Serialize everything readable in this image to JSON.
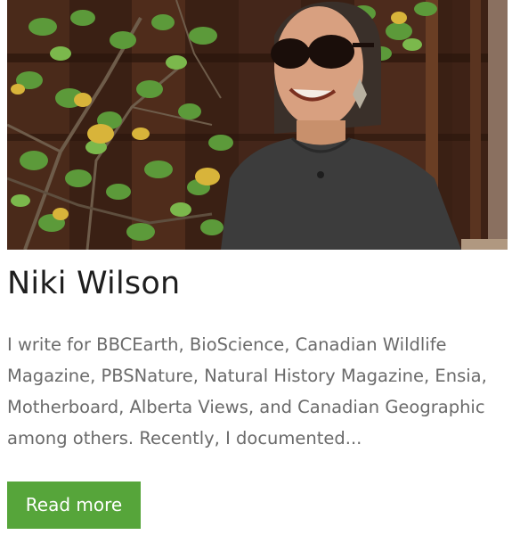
{
  "profile": {
    "name": "Niki Wilson",
    "bio": "I write for BBCEarth, BioScience, Canadian Wildlife Magazine, PBSNature, Natural History Magazine, Ensia, Motherboard, Alberta Views, and Canadian Geographic among others. Recently, I documented...",
    "read_more_label": "Read more"
  },
  "colors": {
    "button_bg": "#56a53a",
    "title_text": "#1e1e1e",
    "body_text": "#6a6a6a"
  }
}
